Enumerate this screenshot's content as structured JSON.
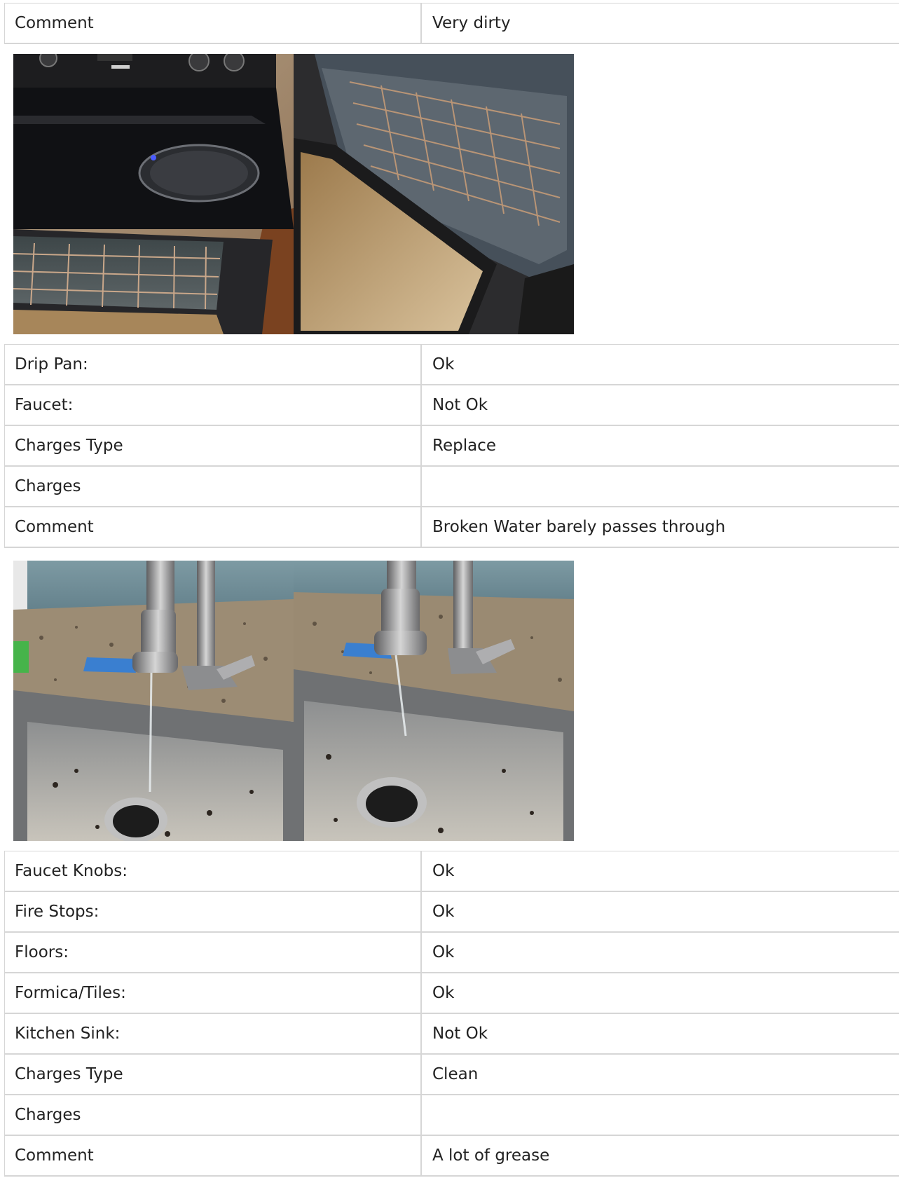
{
  "section1": {
    "rows": [
      {
        "label": "Comment",
        "value": "Very dirty"
      }
    ]
  },
  "photos1": [
    {
      "icon": "stove-oven-photo"
    },
    {
      "icon": "open-oven-photo"
    }
  ],
  "section2": {
    "rows": [
      {
        "label": "Drip Pan:",
        "value": "Ok"
      },
      {
        "label": "Faucet:",
        "value": "Not Ok"
      },
      {
        "label": "Charges Type",
        "value": "Replace"
      },
      {
        "label": "Charges",
        "value": ""
      },
      {
        "label": "Comment",
        "value": "Broken Water barely passes through"
      }
    ]
  },
  "photos2": [
    {
      "icon": "faucet-sink-photo"
    },
    {
      "icon": "faucet-sink-photo"
    }
  ],
  "section3": {
    "rows": [
      {
        "label": "Faucet Knobs:",
        "value": "Ok"
      },
      {
        "label": "Fire Stops:",
        "value": "Ok"
      },
      {
        "label": "Floors:",
        "value": "Ok"
      },
      {
        "label": "Formica/Tiles:",
        "value": "Ok"
      },
      {
        "label": "Kitchen Sink:",
        "value": "Not Ok"
      },
      {
        "label": "Charges Type",
        "value": "Clean"
      },
      {
        "label": "Charges",
        "value": ""
      },
      {
        "label": "Comment",
        "value": "A lot of grease"
      }
    ]
  },
  "colors": {
    "border": "#d6d6d6",
    "text": "#222222"
  }
}
